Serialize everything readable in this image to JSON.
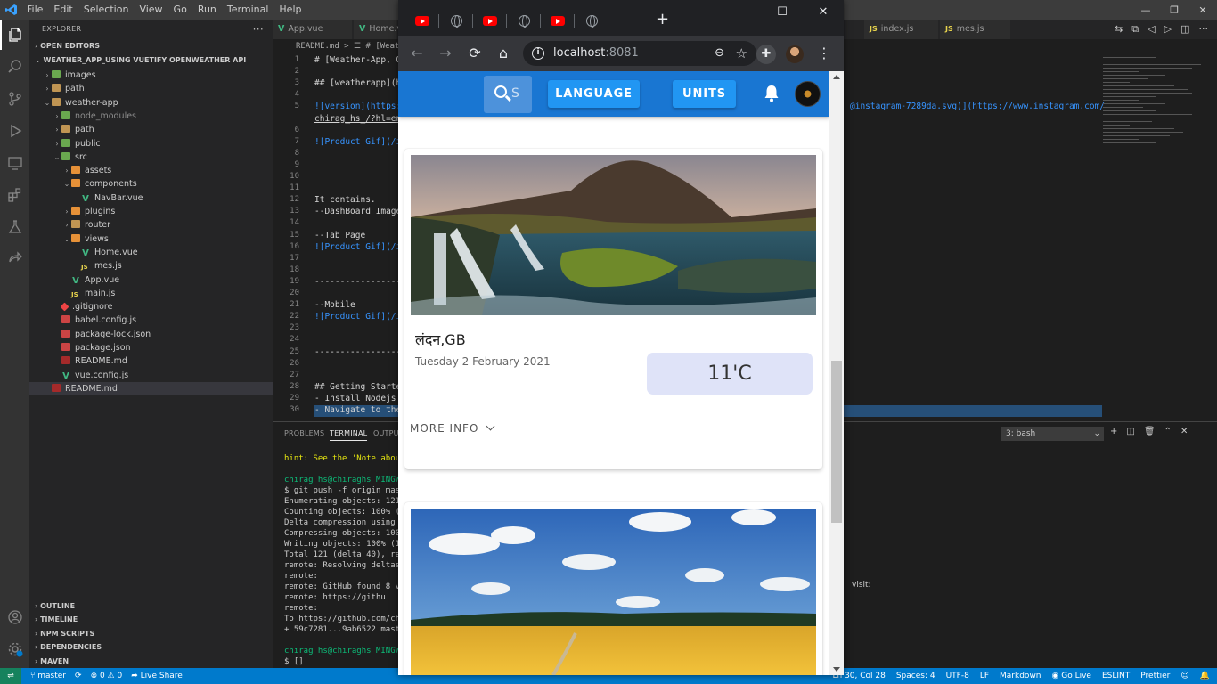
{
  "vscode": {
    "menu": [
      "File",
      "Edit",
      "Selection",
      "View",
      "Go",
      "Run",
      "Terminal",
      "Help"
    ],
    "explorer_title": "EXPLORER",
    "open_editors": "OPEN EDITORS",
    "project": "WEATHER_APP_USING VUETIFY OPENWEATHER API",
    "tree": [
      {
        "label": "images",
        "depth": 1,
        "kind": "folder-g",
        "chev": "›"
      },
      {
        "label": "path",
        "depth": 1,
        "kind": "folder",
        "chev": "›"
      },
      {
        "label": "weather-app",
        "depth": 1,
        "kind": "folder",
        "chev": "⌄"
      },
      {
        "label": "node_modules",
        "depth": 2,
        "kind": "folder-g",
        "chev": "›",
        "dim": true
      },
      {
        "label": "path",
        "depth": 2,
        "kind": "folder",
        "chev": "›"
      },
      {
        "label": "public",
        "depth": 2,
        "kind": "folder-g",
        "chev": "›"
      },
      {
        "label": "src",
        "depth": 2,
        "kind": "folder-g",
        "chev": "⌄"
      },
      {
        "label": "assets",
        "depth": 3,
        "kind": "folder-o",
        "chev": "›"
      },
      {
        "label": "components",
        "depth": 3,
        "kind": "folder-o",
        "chev": "⌄"
      },
      {
        "label": "NavBar.vue",
        "depth": 4,
        "kind": "vue",
        "chev": ""
      },
      {
        "label": "plugins",
        "depth": 3,
        "kind": "folder-o",
        "chev": "›"
      },
      {
        "label": "router",
        "depth": 3,
        "kind": "folder",
        "chev": "›"
      },
      {
        "label": "views",
        "depth": 3,
        "kind": "folder-o",
        "chev": "⌄"
      },
      {
        "label": "Home.vue",
        "depth": 4,
        "kind": "vue",
        "chev": ""
      },
      {
        "label": "mes.js",
        "depth": 4,
        "kind": "js",
        "chev": ""
      },
      {
        "label": "App.vue",
        "depth": 3,
        "kind": "vue",
        "chev": ""
      },
      {
        "label": "main.js",
        "depth": 3,
        "kind": "js",
        "chev": ""
      },
      {
        "label": ".gitignore",
        "depth": 2,
        "kind": "git",
        "chev": ""
      },
      {
        "label": "babel.config.js",
        "depth": 2,
        "kind": "json",
        "chev": ""
      },
      {
        "label": "package-lock.json",
        "depth": 2,
        "kind": "json",
        "chev": ""
      },
      {
        "label": "package.json",
        "depth": 2,
        "kind": "json",
        "chev": ""
      },
      {
        "label": "README.md",
        "depth": 2,
        "kind": "md",
        "chev": ""
      },
      {
        "label": "vue.config.js",
        "depth": 2,
        "kind": "vue",
        "chev": ""
      },
      {
        "label": "README.md",
        "depth": 1,
        "kind": "md",
        "chev": "",
        "selected": true
      }
    ],
    "bottom_sections": [
      "OUTLINE",
      "TIMELINE",
      "NPM SCRIPTS",
      "DEPENDENCIES",
      "MAVEN"
    ],
    "tabs": [
      {
        "label": "App.vue",
        "kind": "vue"
      },
      {
        "label": "Home.vu",
        "kind": "vue"
      },
      {
        "label": "index.js",
        "kind": "js"
      },
      {
        "label": "mes.js",
        "kind": "js"
      }
    ],
    "breadcrumb": "README.md  >  ☰ # [Weath",
    "lines": [
      {
        "n": "1",
        "t": "# [Weather-App, Op"
      },
      {
        "n": "2",
        "t": ""
      },
      {
        "n": "3",
        "t": "## [weatherapp](ht"
      },
      {
        "n": "4",
        "t": ""
      },
      {
        "n": "5",
        "t": "![version](https:/"
      },
      {
        "n": "",
        "t": "chirag_hs_/?hl=en)"
      },
      {
        "n": "6",
        "t": ""
      },
      {
        "n": "7",
        "t": "![Product Gif](/im"
      },
      {
        "n": "8",
        "t": ""
      },
      {
        "n": "9",
        "t": ""
      },
      {
        "n": "10",
        "t": ""
      },
      {
        "n": "11",
        "t": ""
      },
      {
        "n": "12",
        "t": "It contains."
      },
      {
        "n": "13",
        "t": "--DashBoard Image"
      },
      {
        "n": "14",
        "t": ""
      },
      {
        "n": "15",
        "t": "--Tab Page"
      },
      {
        "n": "16",
        "t": "![Product Gif](/im"
      },
      {
        "n": "17",
        "t": ""
      },
      {
        "n": "18",
        "t": ""
      },
      {
        "n": "19",
        "t": "------------------"
      },
      {
        "n": "20",
        "t": ""
      },
      {
        "n": "21",
        "t": "--Mobile"
      },
      {
        "n": "22",
        "t": "![Product Gif](/im"
      },
      {
        "n": "23",
        "t": ""
      },
      {
        "n": "24",
        "t": ""
      },
      {
        "n": "25",
        "t": "------------------"
      },
      {
        "n": "26",
        "t": ""
      },
      {
        "n": "27",
        "t": ""
      },
      {
        "n": "28",
        "t": "## Getting Started"
      },
      {
        "n": "29",
        "t": "- Install Nodejs f"
      },
      {
        "n": "30",
        "t": "- Navigate to the"
      }
    ],
    "line5_tail": "@instagram-7289da.svg)](https://www.instagram.com/",
    "panel_tabs": [
      "PROBLEMS",
      "TERMINAL",
      "OUTPU"
    ],
    "terminal_select": "3: bash",
    "terminal_lines": [
      "hint: See the 'Note about",
      "",
      "chirag hs@chiraghs MINGW64",
      "$ git push -f origin maste",
      "Enumerating objects: 121,",
      "Counting objects: 100% (12",
      "Delta compression using up",
      "Compressing objects: 100%",
      "Writing objects: 100% (121",
      "Total 121 (delta 40), reus",
      "remote: Resolving deltas:",
      "remote:",
      "remote: GitHub found 8 vul",
      "remote:      https://githu",
      "remote:",
      "To https://github.com/chir",
      " + 59c7281...9ab6522 maste",
      "",
      "chirag hs@chiraghs MINGW64",
      "$ []"
    ],
    "terminal_tail": "visit:",
    "status_left": [
      "master",
      "⊗ 0 ⚠ 0",
      "Live Share"
    ],
    "status_right": [
      "Ln 30, Col 28",
      "Spaces: 4",
      "UTF-8",
      "LF",
      "Markdown",
      "Go Live",
      "ESLINT",
      "Prettier"
    ]
  },
  "chrome": {
    "url_host": "localhost",
    "url_port": ":8081",
    "tab_icons": [
      "youtube-icon",
      "globe-icon",
      "youtube-icon",
      "globe-icon",
      "youtube-icon",
      "globe-icon"
    ]
  },
  "app": {
    "search_placeholder": "S",
    "language_label": "LANGUAGE",
    "units_label": "UNITS",
    "cards": [
      {
        "city": "लंदन,GB",
        "date": "Tuesday 2 February 2021",
        "temp": "11'C",
        "more": "MORE INFO"
      }
    ]
  }
}
